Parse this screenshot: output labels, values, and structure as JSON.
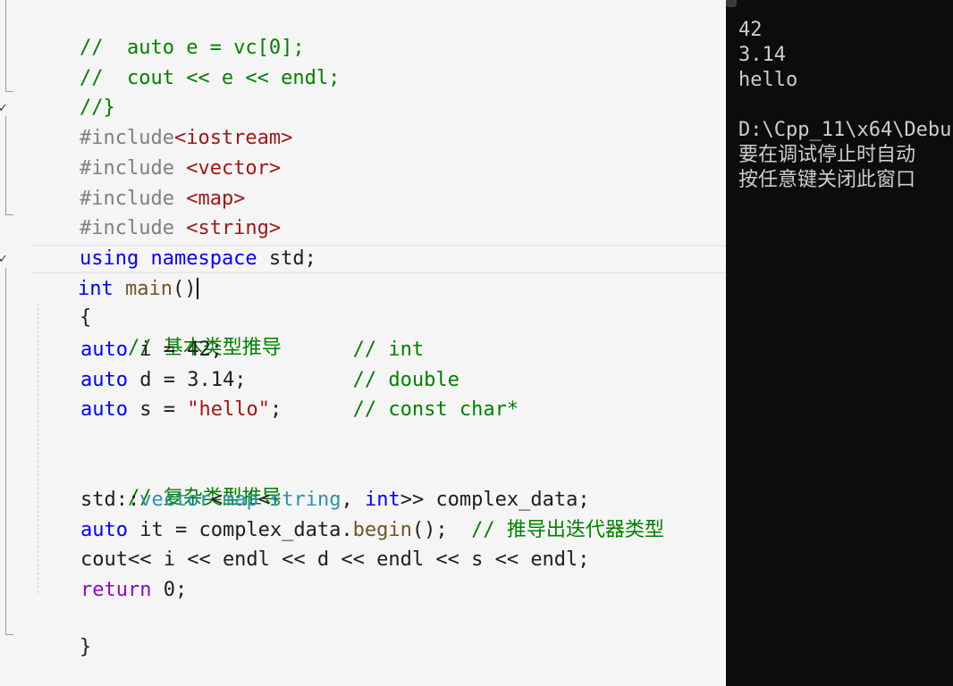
{
  "editor": {
    "lines": [
      "//  auto e = vc[0];",
      "//  cout << e << endl;",
      "//}",
      "#include<iostream>",
      "#include <vector>",
      "#include <map>",
      "#include <string>",
      "using namespace std;",
      "int main()",
      "{",
      "// 基本类型推导",
      "auto i = 42;           // int",
      "auto d = 3.14;         // double",
      "auto s = \"hello\";      // const char*",
      "",
      "// 复杂类型推导",
      "std::vector<map<string, int>> complex_data;",
      "auto it = complex_data.begin();  // 推导出迭代器类型",
      "cout<< i << endl << d << endl << s << endl;",
      "return 0;",
      "}"
    ]
  },
  "console": {
    "lines": [
      "42",
      "3.14",
      "hello",
      "",
      "D:\\Cpp_11\\x64\\Debu",
      "要在调试停止时自动",
      "按任意键关闭此窗口"
    ]
  }
}
